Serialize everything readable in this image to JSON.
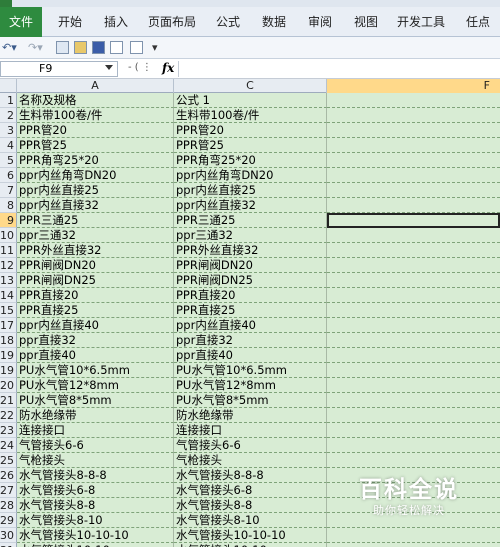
{
  "ribbon": {
    "tabs": [
      "文件",
      "开始",
      "插入",
      "页面布局",
      "公式",
      "数据",
      "审阅",
      "视图",
      "开发工具",
      "任点"
    ]
  },
  "formula_bar": {
    "name_box": "F9",
    "fx_label": "fx",
    "formula": ""
  },
  "columns": [
    "A",
    "C",
    "F"
  ],
  "rows": [
    {
      "num": "1",
      "a": "名称及规格",
      "c": "公式 1"
    },
    {
      "num": "2",
      "a": "生料带100卷/件",
      "c": "生料带100卷/件"
    },
    {
      "num": "3",
      "a": "PPR管20",
      "c": "PPR管20"
    },
    {
      "num": "4",
      "a": "PPR管25",
      "c": "PPR管25"
    },
    {
      "num": "5",
      "a": "PPR角弯25*20",
      "c": "PPR角弯25*20"
    },
    {
      "num": "6",
      "a": "ppr内丝角弯DN20",
      "c": "ppr内丝角弯DN20"
    },
    {
      "num": "7",
      "a": "ppr内丝直接25",
      "c": "ppr内丝直接25"
    },
    {
      "num": "8",
      "a": "ppr内丝直接32",
      "c": "ppr内丝直接32"
    },
    {
      "num": "9",
      "a": "PPR三通25",
      "c": "PPR三通25"
    },
    {
      "num": "10",
      "a": "ppr三通32",
      "c": "ppr三通32"
    },
    {
      "num": "11",
      "a": "PPR外丝直接32",
      "c": "PPR外丝直接32"
    },
    {
      "num": "12",
      "a": "PPR闸阀DN20",
      "c": "PPR闸阀DN20"
    },
    {
      "num": "13",
      "a": "PPR闸阀DN25",
      "c": "PPR闸阀DN25"
    },
    {
      "num": "14",
      "a": "PPR直接20",
      "c": "PPR直接20"
    },
    {
      "num": "15",
      "a": "PPR直接25",
      "c": "PPR直接25"
    },
    {
      "num": "17",
      "a": "ppr内丝直接40",
      "c": "ppr内丝直接40"
    },
    {
      "num": "18",
      "a": "ppr直接32",
      "c": "ppr直接32"
    },
    {
      "num": "19",
      "a": "ppr直接40",
      "c": "ppr直接40"
    },
    {
      "num": "19",
      "a": "PU水气管10*6.5mm",
      "c": "PU水气管10*6.5mm"
    },
    {
      "num": "20",
      "a": "PU水气管12*8mm",
      "c": "PU水气管12*8mm"
    },
    {
      "num": "21",
      "a": "PU水气管8*5mm",
      "c": "PU水气管8*5mm"
    },
    {
      "num": "22",
      "a": "防水绝缘带",
      "c": "防水绝缘带"
    },
    {
      "num": "23",
      "a": "连接接口",
      "c": "连接接口"
    },
    {
      "num": "24",
      "a": "气管接头6-6",
      "c": "气管接头6-6"
    },
    {
      "num": "25",
      "a": "气枪接头",
      "c": "气枪接头"
    },
    {
      "num": "26",
      "a": "水气管接头8-8-8",
      "c": "水气管接头8-8-8"
    },
    {
      "num": "27",
      "a": "水气管接头6-8",
      "c": "水气管接头6-8"
    },
    {
      "num": "28",
      "a": "水气管接头8-8",
      "c": "水气管接头8-8"
    },
    {
      "num": "29",
      "a": "水气管接头8-10",
      "c": "水气管接头8-10"
    },
    {
      "num": "30",
      "a": "水气管接头10-10-10",
      "c": "水气管接头10-10-10"
    },
    {
      "num": "31",
      "a": "水气管接头10-10",
      "c": "水气管接头10-10"
    }
  ],
  "selected_row": "9",
  "watermark": {
    "title": "百科全说",
    "subtitle": "助你轻松解决"
  }
}
